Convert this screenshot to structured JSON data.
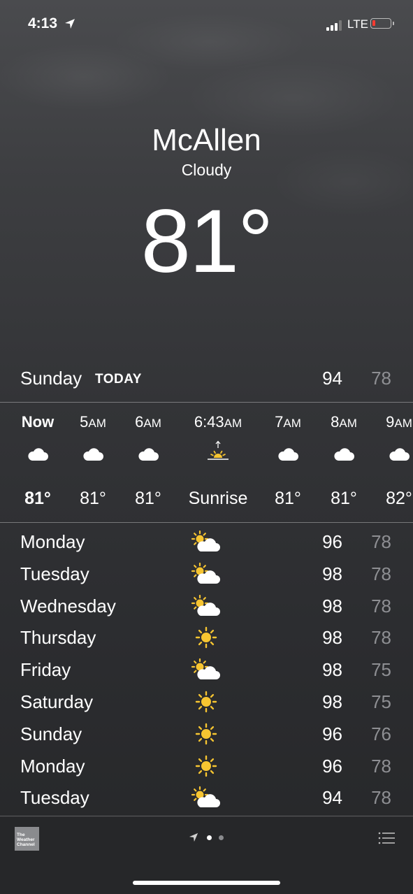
{
  "status_bar": {
    "time": "4:13",
    "network": "LTE"
  },
  "location": {
    "city": "McAllen",
    "condition": "Cloudy",
    "temperature": "81°"
  },
  "today": {
    "day": "Sunday",
    "label": "TODAY",
    "high": "94",
    "low": "78"
  },
  "hourly": [
    {
      "time": "Now",
      "suffix": "",
      "icon": "cloud-icon",
      "temp": "81°",
      "bold": true
    },
    {
      "time": "5",
      "suffix": "AM",
      "icon": "cloud-icon",
      "temp": "81°"
    },
    {
      "time": "6",
      "suffix": "AM",
      "icon": "cloud-icon",
      "temp": "81°"
    },
    {
      "time": "6:43",
      "suffix": "AM",
      "icon": "sunrise-icon",
      "temp": "Sunrise"
    },
    {
      "time": "7",
      "suffix": "AM",
      "icon": "cloud-icon",
      "temp": "81°"
    },
    {
      "time": "8",
      "suffix": "AM",
      "icon": "cloud-icon",
      "temp": "81°"
    },
    {
      "time": "9",
      "suffix": "AM",
      "icon": "cloud-icon",
      "temp": "82°"
    }
  ],
  "daily": [
    {
      "day": "Monday",
      "icon": "partly-cloudy-icon",
      "high": "96",
      "low": "78"
    },
    {
      "day": "Tuesday",
      "icon": "partly-cloudy-icon",
      "high": "98",
      "low": "78"
    },
    {
      "day": "Wednesday",
      "icon": "partly-cloudy-icon",
      "high": "98",
      "low": "78"
    },
    {
      "day": "Thursday",
      "icon": "sun-icon",
      "high": "98",
      "low": "78"
    },
    {
      "day": "Friday",
      "icon": "partly-cloudy-icon",
      "high": "98",
      "low": "75"
    },
    {
      "day": "Saturday",
      "icon": "sun-icon",
      "high": "98",
      "low": "75"
    },
    {
      "day": "Sunday",
      "icon": "sun-icon",
      "high": "96",
      "low": "76"
    },
    {
      "day": "Monday",
      "icon": "sun-icon",
      "high": "96",
      "low": "78"
    },
    {
      "day": "Tuesday",
      "icon": "partly-cloudy-icon",
      "high": "94",
      "low": "78"
    }
  ],
  "tab_bar": {
    "brand_text": "The Weather Channel",
    "pages": 2,
    "active_page": 0
  },
  "colors": {
    "sun": "#f7c531",
    "low_temp": "#8e8f93",
    "battery_low": "#ff3b30"
  }
}
